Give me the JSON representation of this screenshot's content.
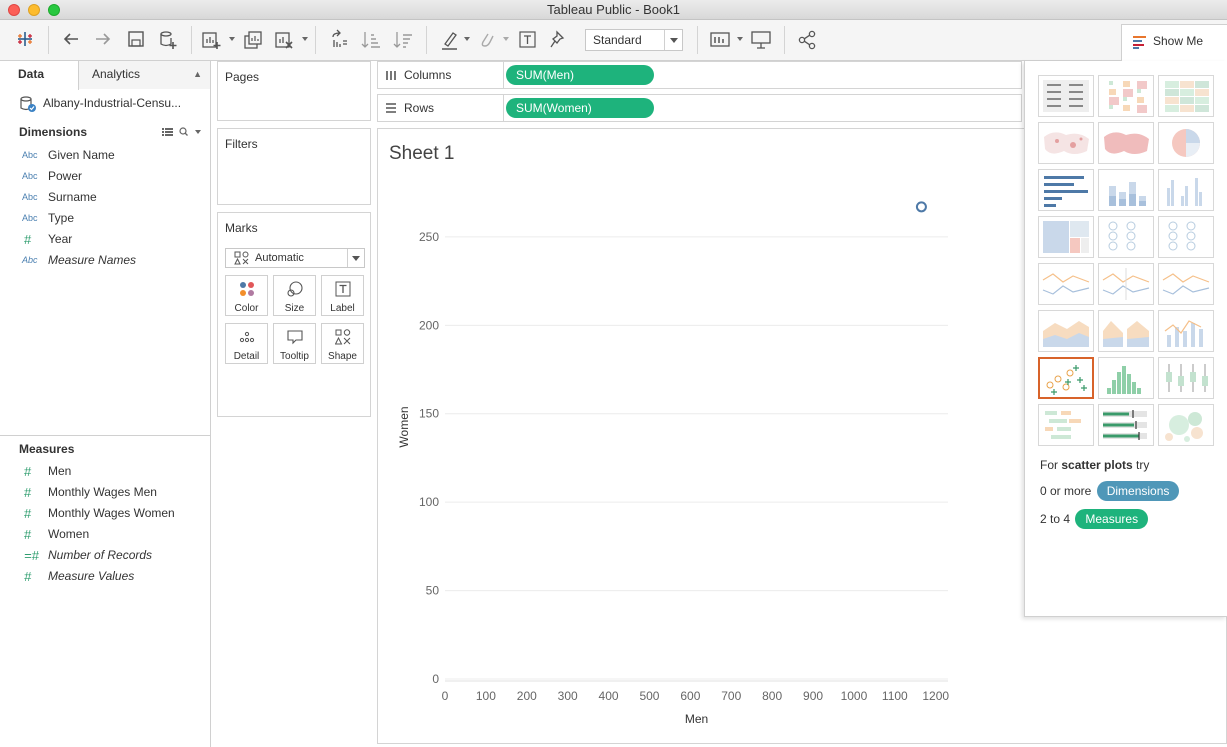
{
  "window": {
    "title": "Tableau Public - Book1"
  },
  "toolbar": {
    "fit_select": "Standard",
    "show_me_label": "Show Me",
    "icons": [
      "tableau-logo-icon",
      "undo-icon",
      "redo-icon",
      "save-icon",
      "new-datasource-icon",
      "new-worksheet-icon",
      "duplicate-sheet-icon",
      "clear-sheet-icon",
      "swap-icon",
      "sort-ascending-icon",
      "sort-descending-icon",
      "highlight-icon",
      "group-icon",
      "label-icon",
      "pin-icon",
      "show-cards-icon",
      "presentation-icon",
      "share-icon"
    ]
  },
  "data_pane": {
    "tabs": [
      {
        "label": "Data"
      },
      {
        "label": "Analytics"
      }
    ],
    "datasource": "Albany-Industrial-Censu...",
    "dimensions_header": "Dimensions",
    "dimensions": [
      {
        "type": "Abc",
        "label": "Given Name",
        "italic": false
      },
      {
        "type": "Abc",
        "label": "Power",
        "italic": false
      },
      {
        "type": "Abc",
        "label": "Surname",
        "italic": false
      },
      {
        "type": "Abc",
        "label": "Type",
        "italic": false
      },
      {
        "type": "#",
        "label": "Year",
        "italic": false
      },
      {
        "type": "Abc",
        "label": "Measure Names",
        "italic": true
      }
    ],
    "measures_header": "Measures",
    "measures": [
      {
        "type": "#",
        "label": "Men",
        "italic": false
      },
      {
        "type": "#",
        "label": "Monthly Wages Men",
        "italic": false
      },
      {
        "type": "#",
        "label": "Monthly Wages Women",
        "italic": false
      },
      {
        "type": "#",
        "label": "Women",
        "italic": false
      },
      {
        "type": "=#",
        "label": "Number of Records",
        "italic": true
      },
      {
        "type": "#",
        "label": "Measure Values",
        "italic": true
      }
    ]
  },
  "cards": {
    "pages": "Pages",
    "filters": "Filters",
    "marks": "Marks",
    "mark_type": "Automatic",
    "mark_buttons": [
      {
        "label": "Color",
        "icon": "color-icon"
      },
      {
        "label": "Size",
        "icon": "size-icon"
      },
      {
        "label": "Label",
        "icon": "label-icon"
      },
      {
        "label": "Detail",
        "icon": "detail-icon"
      },
      {
        "label": "Tooltip",
        "icon": "tooltip-icon"
      },
      {
        "label": "Shape",
        "icon": "shape-icon"
      }
    ]
  },
  "shelves": {
    "columns_label": "Columns",
    "columns_pill": "SUM(Men)",
    "rows_label": "Rows",
    "rows_pill": "SUM(Women)"
  },
  "sheet": {
    "title": "Sheet 1"
  },
  "chart_data": {
    "type": "scatter",
    "title": "Sheet 1",
    "xlabel": "Men",
    "ylabel": "Women",
    "x_ticks": [
      0,
      100,
      200,
      300,
      400,
      500,
      600,
      700,
      800,
      900,
      1000,
      1100,
      1200
    ],
    "y_ticks": [
      0,
      50,
      100,
      150,
      200,
      250
    ],
    "xlim": [
      0,
      1230
    ],
    "ylim": [
      0,
      285
    ],
    "points": [
      {
        "x": 1165,
        "y": 267
      }
    ],
    "grid": true,
    "mark_color": "#4e79a7"
  },
  "show_me": {
    "selected_chart": "scatter plots",
    "hint_prefix": "For",
    "hint_bold": "scatter plots",
    "hint_suffix": "try",
    "req1_text": "0 or more",
    "req1_pill": "Dimensions",
    "req2_text": "2 to 4",
    "req2_pill": "Measures"
  }
}
